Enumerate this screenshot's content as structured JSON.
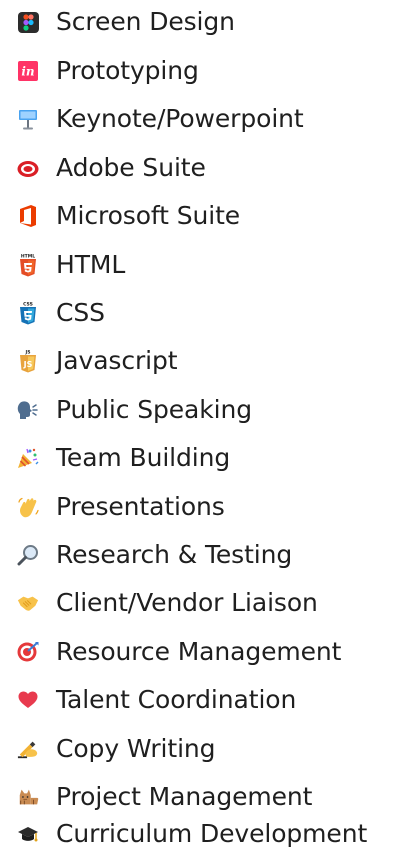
{
  "skills": [
    {
      "label": "Screen Design",
      "icon": "figma-icon"
    },
    {
      "label": "Prototyping",
      "icon": "invision-icon"
    },
    {
      "label": "Keynote/Powerpoint",
      "icon": "keynote-icon"
    },
    {
      "label": "Adobe Suite",
      "icon": "adobe-creative-cloud-icon"
    },
    {
      "label": "Microsoft Suite",
      "icon": "microsoft-office-icon"
    },
    {
      "label": "HTML",
      "icon": "html5-icon"
    },
    {
      "label": "CSS",
      "icon": "css3-icon"
    },
    {
      "label": "Javascript",
      "icon": "javascript-icon"
    },
    {
      "label": "Public Speaking",
      "icon": "speaking-head-icon"
    },
    {
      "label": "Team Building",
      "icon": "party-popper-icon"
    },
    {
      "label": "Presentations",
      "icon": "waving-hand-icon"
    },
    {
      "label": "Research & Testing",
      "icon": "magnifying-glass-icon"
    },
    {
      "label": "Client/Vendor Liaison",
      "icon": "handshake-icon"
    },
    {
      "label": "Resource Management",
      "icon": "direct-hit-icon"
    },
    {
      "label": "Talent Coordination",
      "icon": "heart-icon"
    },
    {
      "label": "Copy Writing",
      "icon": "writing-hand-icon"
    },
    {
      "label": "Project Management",
      "icon": "cat-icon"
    },
    {
      "label": "Curriculum Development",
      "icon": "graduation-cap-icon"
    }
  ]
}
